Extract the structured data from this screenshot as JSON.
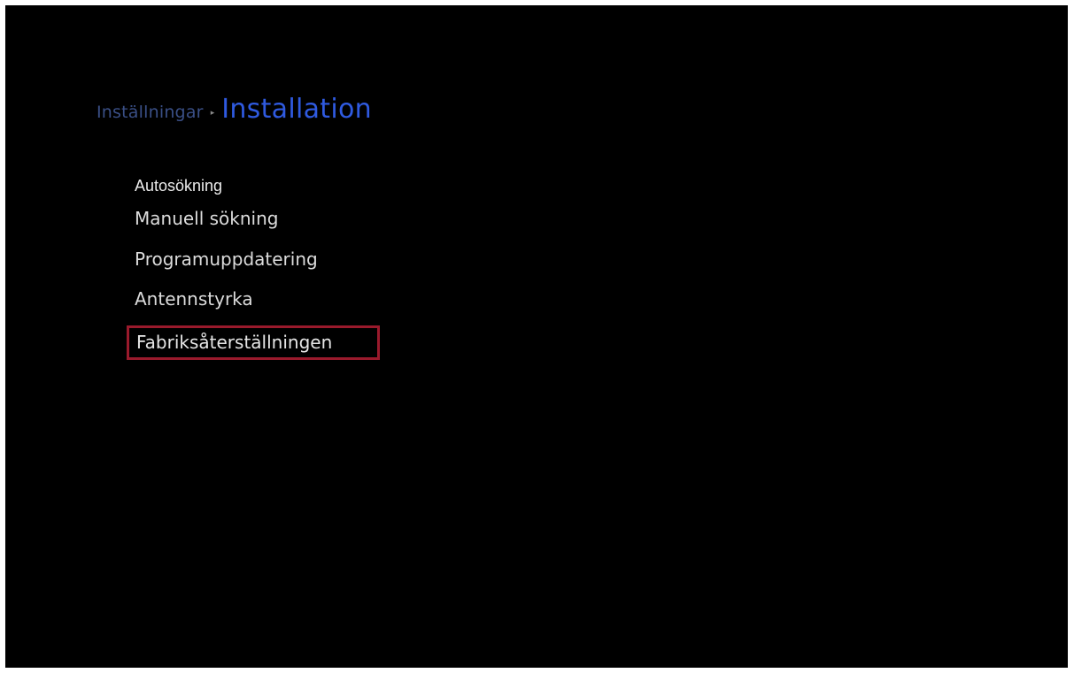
{
  "breadcrumb": {
    "parent": "Inställningar",
    "separator": "▸",
    "current": "Installation"
  },
  "menu": {
    "items": [
      {
        "label": "Autosökning"
      },
      {
        "label": "Manuell sökning"
      },
      {
        "label": "Programuppdatering"
      },
      {
        "label": "Antennstyrka"
      },
      {
        "label": "Fabriksåterställningen",
        "selected": true
      }
    ]
  },
  "colors": {
    "background": "#000000",
    "breadcrumb_parent": "#3a4f86",
    "breadcrumb_current": "#2f5ae0",
    "menu_text": "#dcdcdc",
    "selection_border": "#9a1a2c"
  }
}
